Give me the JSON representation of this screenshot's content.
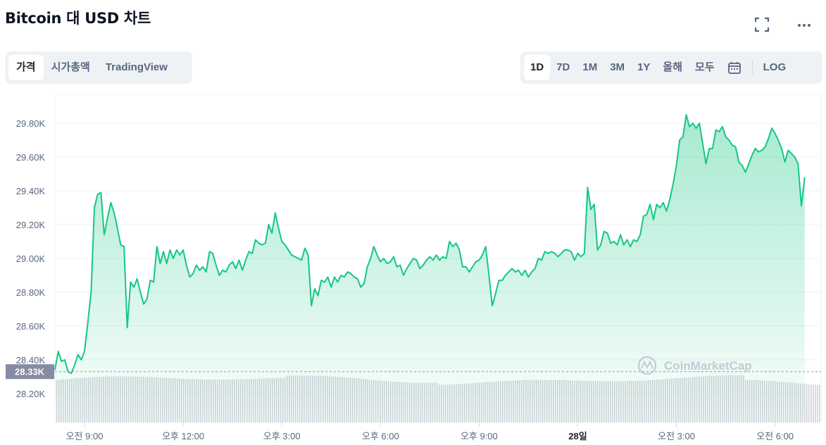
{
  "header": {
    "title": "Bitcoin 대 USD 차트"
  },
  "view_tabs": [
    {
      "label": "가격",
      "active": true
    },
    {
      "label": "시가총액",
      "active": false
    },
    {
      "label": "TradingView",
      "active": false
    }
  ],
  "range_tabs": [
    {
      "label": "1D",
      "active": true
    },
    {
      "label": "7D",
      "active": false
    },
    {
      "label": "1M",
      "active": false
    },
    {
      "label": "3M",
      "active": false
    },
    {
      "label": "1Y",
      "active": false
    },
    {
      "label": "올해",
      "active": false
    },
    {
      "label": "모두",
      "active": false
    }
  ],
  "log_label": "LOG",
  "icons": {
    "fullscreen": "fullscreen-icon",
    "more": "more-dots-icon",
    "calendar": "calendar-icon"
  },
  "colors": {
    "line": "#16c784",
    "area_top": "#16c784",
    "volume": "#cfd3da",
    "current_price_bg": "#858ca2"
  },
  "chart_data": {
    "type": "area",
    "title": "",
    "xlabel": "",
    "ylabel": "",
    "ylim": [
      28200,
      29900
    ],
    "y_ticks": [
      "28.20K",
      "28.40K",
      "28.60K",
      "28.80K",
      "29.00K",
      "29.20K",
      "29.40K",
      "29.60K",
      "29.80K"
    ],
    "y_tick_values": [
      28200,
      28400,
      28600,
      28800,
      29000,
      29200,
      29400,
      29600,
      29800
    ],
    "x_ticks": [
      {
        "label": "오전 9:00",
        "hour": 9,
        "bold": false
      },
      {
        "label": "오후 12:00",
        "hour": 12,
        "bold": false
      },
      {
        "label": "오후 3:00",
        "hour": 15,
        "bold": false
      },
      {
        "label": "오후 6:00",
        "hour": 18,
        "bold": false
      },
      {
        "label": "오후 9:00",
        "hour": 21,
        "bold": false
      },
      {
        "label": "28일",
        "hour": 24,
        "bold": true
      },
      {
        "label": "오전 3:00",
        "hour": 27,
        "bold": false
      },
      {
        "label": "오전 6:00",
        "hour": 30,
        "bold": false
      }
    ],
    "x_start_hour": 8.1,
    "x_end_hour": 31.4,
    "current_price": {
      "label": "28.33K",
      "value": 28330
    },
    "watermark": "CoinMarketCap",
    "series": [
      {
        "values": [
          [
            8.1,
            28340
          ],
          [
            8.2,
            28450
          ],
          [
            8.3,
            28390
          ],
          [
            8.4,
            28400
          ],
          [
            8.5,
            28330
          ],
          [
            8.6,
            28320
          ],
          [
            8.7,
            28370
          ],
          [
            8.8,
            28430
          ],
          [
            8.9,
            28400
          ],
          [
            9.0,
            28450
          ],
          [
            9.1,
            28620
          ],
          [
            9.2,
            28800
          ],
          [
            9.3,
            29300
          ],
          [
            9.4,
            29380
          ],
          [
            9.5,
            29390
          ],
          [
            9.6,
            29140
          ],
          [
            9.7,
            29240
          ],
          [
            9.8,
            29330
          ],
          [
            9.9,
            29270
          ],
          [
            10.0,
            29180
          ],
          [
            10.1,
            29080
          ],
          [
            10.2,
            29070
          ],
          [
            10.3,
            28590
          ],
          [
            10.4,
            28860
          ],
          [
            10.5,
            28830
          ],
          [
            10.6,
            28880
          ],
          [
            10.7,
            28800
          ],
          [
            10.8,
            28730
          ],
          [
            10.9,
            28760
          ],
          [
            11.0,
            28870
          ],
          [
            11.1,
            28860
          ],
          [
            11.2,
            29070
          ],
          [
            11.3,
            28970
          ],
          [
            11.4,
            29040
          ],
          [
            11.5,
            28970
          ],
          [
            11.6,
            29050
          ],
          [
            11.7,
            29000
          ],
          [
            11.8,
            29050
          ],
          [
            11.9,
            29020
          ],
          [
            12.0,
            29050
          ],
          [
            12.1,
            28960
          ],
          [
            12.2,
            28890
          ],
          [
            12.3,
            28910
          ],
          [
            12.4,
            28960
          ],
          [
            12.5,
            28930
          ],
          [
            12.6,
            28950
          ],
          [
            12.7,
            28920
          ],
          [
            12.8,
            29040
          ],
          [
            12.9,
            29030
          ],
          [
            13.0,
            28960
          ],
          [
            13.1,
            28900
          ],
          [
            13.2,
            28930
          ],
          [
            13.3,
            28920
          ],
          [
            13.4,
            28960
          ],
          [
            13.5,
            28980
          ],
          [
            13.6,
            28940
          ],
          [
            13.7,
            28990
          ],
          [
            13.8,
            28930
          ],
          [
            13.9,
            28990
          ],
          [
            14.0,
            29040
          ],
          [
            14.1,
            29030
          ],
          [
            14.2,
            29110
          ],
          [
            14.3,
            29090
          ],
          [
            14.4,
            29080
          ],
          [
            14.5,
            29090
          ],
          [
            14.6,
            29200
          ],
          [
            14.7,
            29150
          ],
          [
            14.8,
            29270
          ],
          [
            14.9,
            29180
          ],
          [
            15.0,
            29100
          ],
          [
            15.1,
            29080
          ],
          [
            15.2,
            29050
          ],
          [
            15.3,
            29020
          ],
          [
            15.4,
            29010
          ],
          [
            15.5,
            29000
          ],
          [
            15.6,
            28990
          ],
          [
            15.7,
            29060
          ],
          [
            15.8,
            29020
          ],
          [
            15.9,
            28720
          ],
          [
            16.0,
            28820
          ],
          [
            16.1,
            28780
          ],
          [
            16.2,
            28870
          ],
          [
            16.3,
            28860
          ],
          [
            16.4,
            28890
          ],
          [
            16.5,
            28830
          ],
          [
            16.6,
            28890
          ],
          [
            16.7,
            28860
          ],
          [
            16.8,
            28900
          ],
          [
            16.9,
            28890
          ],
          [
            17.0,
            28920
          ],
          [
            17.1,
            28910
          ],
          [
            17.2,
            28890
          ],
          [
            17.3,
            28880
          ],
          [
            17.4,
            28830
          ],
          [
            17.5,
            28850
          ],
          [
            17.6,
            28950
          ],
          [
            17.7,
            29000
          ],
          [
            17.8,
            29070
          ],
          [
            17.9,
            29020
          ],
          [
            18.0,
            28980
          ],
          [
            18.1,
            29000
          ],
          [
            18.2,
            28970
          ],
          [
            18.3,
            28980
          ],
          [
            18.4,
            29010
          ],
          [
            18.5,
            28950
          ],
          [
            18.6,
            28960
          ],
          [
            18.7,
            28900
          ],
          [
            18.8,
            28940
          ],
          [
            18.9,
            28970
          ],
          [
            19.0,
            29000
          ],
          [
            19.1,
            28990
          ],
          [
            19.2,
            28940
          ],
          [
            19.3,
            28960
          ],
          [
            19.4,
            28990
          ],
          [
            19.5,
            29010
          ],
          [
            19.6,
            28990
          ],
          [
            19.7,
            29020
          ],
          [
            19.8,
            28990
          ],
          [
            19.9,
            29010
          ],
          [
            20.0,
            29000
          ],
          [
            20.1,
            29100
          ],
          [
            20.2,
            29070
          ],
          [
            20.3,
            29090
          ],
          [
            20.4,
            29050
          ],
          [
            20.5,
            28950
          ],
          [
            20.6,
            28950
          ],
          [
            20.7,
            28920
          ],
          [
            20.8,
            28950
          ],
          [
            20.9,
            28980
          ],
          [
            21.0,
            28990
          ],
          [
            21.1,
            29020
          ],
          [
            21.2,
            29070
          ],
          [
            21.3,
            28900
          ],
          [
            21.4,
            28720
          ],
          [
            21.5,
            28790
          ],
          [
            21.6,
            28870
          ],
          [
            21.7,
            28870
          ],
          [
            21.8,
            28900
          ],
          [
            21.9,
            28920
          ],
          [
            22.0,
            28940
          ],
          [
            22.1,
            28920
          ],
          [
            22.2,
            28930
          ],
          [
            22.3,
            28900
          ],
          [
            22.4,
            28930
          ],
          [
            22.5,
            28890
          ],
          [
            22.6,
            28920
          ],
          [
            22.7,
            28940
          ],
          [
            22.8,
            29000
          ],
          [
            22.9,
            28990
          ],
          [
            23.0,
            29040
          ],
          [
            23.1,
            29030
          ],
          [
            23.2,
            29040
          ],
          [
            23.3,
            29030
          ],
          [
            23.4,
            29010
          ],
          [
            23.5,
            29030
          ],
          [
            23.6,
            29050
          ],
          [
            23.7,
            29050
          ],
          [
            23.8,
            29040
          ],
          [
            23.9,
            28990
          ],
          [
            24.0,
            29030
          ],
          [
            24.1,
            29010
          ],
          [
            24.2,
            29030
          ],
          [
            24.3,
            29420
          ],
          [
            24.4,
            29290
          ],
          [
            24.5,
            29320
          ],
          [
            24.6,
            29050
          ],
          [
            24.7,
            29080
          ],
          [
            24.8,
            29160
          ],
          [
            24.9,
            29150
          ],
          [
            25.0,
            29090
          ],
          [
            25.1,
            29100
          ],
          [
            25.2,
            29080
          ],
          [
            25.3,
            29140
          ],
          [
            25.4,
            29080
          ],
          [
            25.5,
            29110
          ],
          [
            25.6,
            29070
          ],
          [
            25.7,
            29110
          ],
          [
            25.8,
            29100
          ],
          [
            25.9,
            29140
          ],
          [
            26.0,
            29250
          ],
          [
            26.1,
            29260
          ],
          [
            26.2,
            29320
          ],
          [
            26.3,
            29230
          ],
          [
            26.4,
            29320
          ],
          [
            26.5,
            29300
          ],
          [
            26.6,
            29330
          ],
          [
            26.7,
            29280
          ],
          [
            26.8,
            29350
          ],
          [
            26.9,
            29440
          ],
          [
            27.0,
            29550
          ],
          [
            27.1,
            29700
          ],
          [
            27.2,
            29720
          ],
          [
            27.3,
            29850
          ],
          [
            27.4,
            29780
          ],
          [
            27.5,
            29800
          ],
          [
            27.6,
            29770
          ],
          [
            27.7,
            29800
          ],
          [
            27.8,
            29680
          ],
          [
            27.9,
            29560
          ],
          [
            28.0,
            29650
          ],
          [
            28.1,
            29650
          ],
          [
            28.2,
            29760
          ],
          [
            28.3,
            29750
          ],
          [
            28.4,
            29780
          ],
          [
            28.5,
            29720
          ],
          [
            28.6,
            29700
          ],
          [
            28.7,
            29670
          ],
          [
            28.8,
            29660
          ],
          [
            28.9,
            29570
          ],
          [
            29.0,
            29550
          ],
          [
            29.1,
            29510
          ],
          [
            29.2,
            29560
          ],
          [
            29.3,
            29610
          ],
          [
            29.4,
            29650
          ],
          [
            29.5,
            29630
          ],
          [
            29.6,
            29640
          ],
          [
            29.7,
            29660
          ],
          [
            29.8,
            29710
          ],
          [
            29.9,
            29770
          ],
          [
            30.0,
            29740
          ],
          [
            30.1,
            29700
          ],
          [
            30.2,
            29650
          ],
          [
            30.3,
            29570
          ],
          [
            30.4,
            29640
          ],
          [
            30.5,
            29620
          ],
          [
            30.6,
            29600
          ],
          [
            30.7,
            29560
          ],
          [
            30.8,
            29310
          ],
          [
            30.9,
            29480
          ]
        ]
      }
    ]
  }
}
